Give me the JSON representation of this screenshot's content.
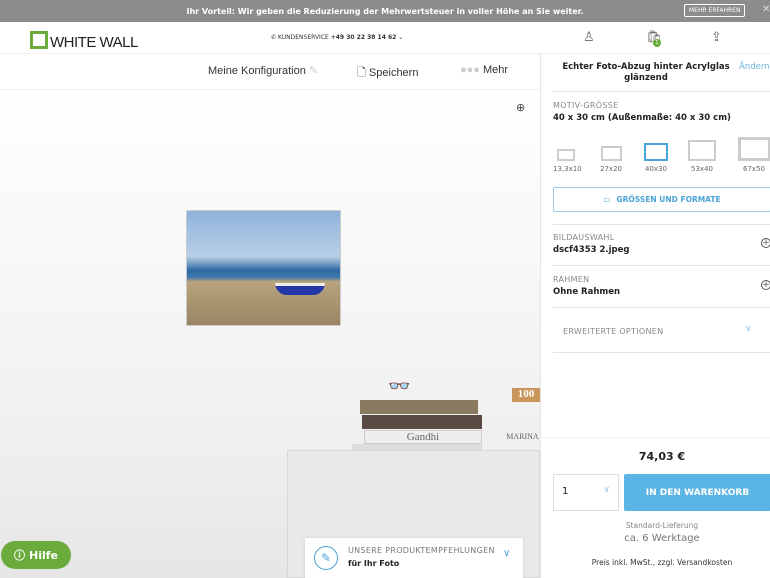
{
  "banner": {
    "text": "Ihr Vorteil: Wir geben die Reduzierung der Mehrwertsteuer in voller Höhe an Sie weiter.",
    "button": "MEHR ERFAHREN"
  },
  "header": {
    "logo": "WHITE WALL",
    "service_label": "KUNDENSERVICE",
    "service_phone": "+49 30 22 38 14 62",
    "cart_count": "1"
  },
  "toolbar": {
    "config": "Meine Konfiguration",
    "save": "Speichern",
    "more": "Mehr"
  },
  "scene": {
    "book1": "Gandhi",
    "book2": "MARINA",
    "book3": "100"
  },
  "help": "Hilfe",
  "reco": {
    "title": "UNSERE PRODUKTEMPFEHLUNGEN",
    "subtitle": "für Ihr Foto"
  },
  "panel": {
    "product": "Echter Foto-Abzug hinter Acrylglas glänzend",
    "change": "Ändern",
    "size_label": "MOTIV-GRÖSSE",
    "size_value": "40 x 30 cm (Außenmaße: 40 x 30 cm)",
    "sizes": [
      "13,3x10",
      "27x20",
      "40x30",
      "53x40",
      "67x50"
    ],
    "selected_size": "40x30",
    "formats_button": "GRÖSSEN UND FORMATE",
    "image_label": "BILDAUSWAHL",
    "image_value": "dscf4353 2.jpeg",
    "frame_label": "RAHMEN",
    "frame_value": "Ohne Rahmen",
    "advanced": "ERWEITERTE OPTIONEN",
    "price": "74,03 €",
    "quantity": "1",
    "cart_button": "IN DEN WARENKORB",
    "delivery_label": "Standard-Lieferung",
    "delivery_value": "ca. 6 Werktage",
    "price_note": "Preis inkl. MwSt., zzgl. Versandkosten"
  },
  "colors": {
    "accent": "#5ab4e4",
    "brand": "#6aab3b"
  }
}
